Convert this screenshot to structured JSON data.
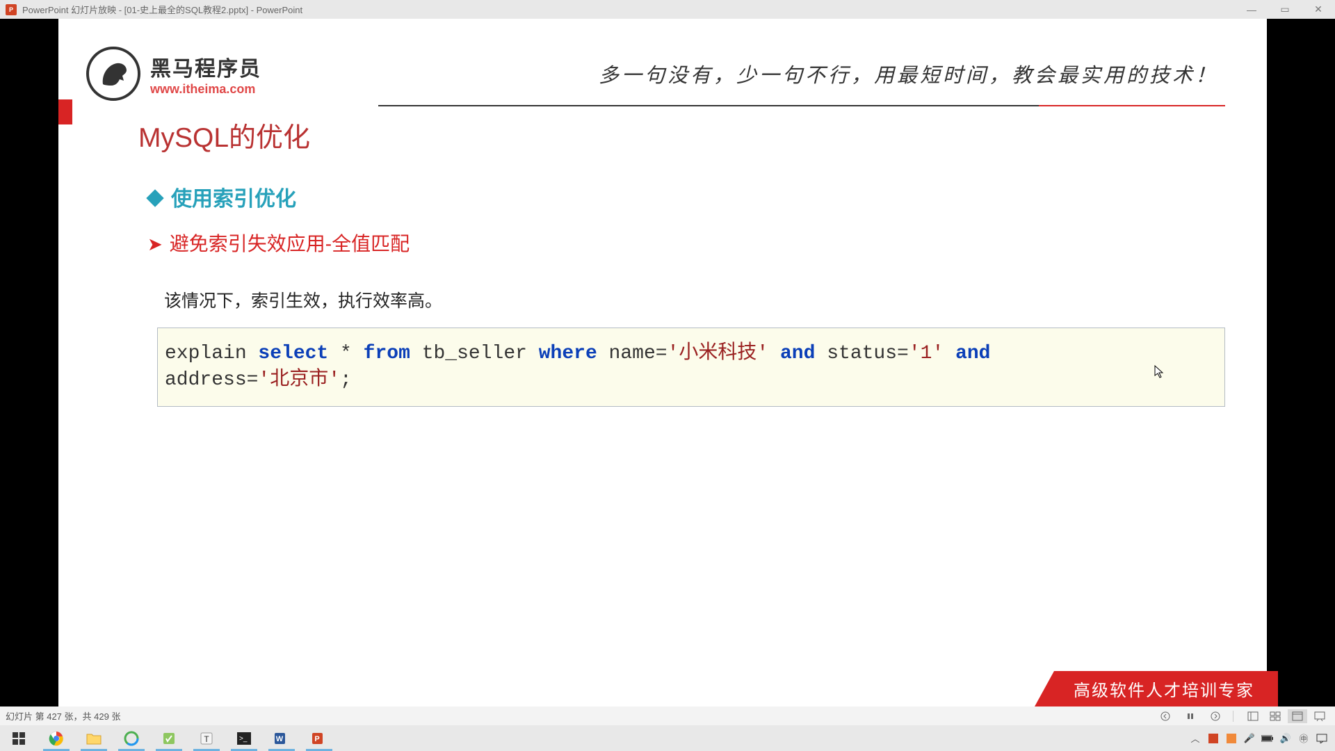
{
  "titlebar": {
    "app_icon_label": "P",
    "title": "PowerPoint 幻灯片放映 - [01-史上最全的SQL教程2.pptx] - PowerPoint"
  },
  "slide": {
    "logo_cn": "黑马程序员",
    "logo_url": "www.itheima.com",
    "slogan": "多一句没有，少一句不行，用最短时间，教会最实用的技术！",
    "title": "MySQL的优化",
    "sub1": "使用索引优化",
    "sub2": "避免索引失效应用-全值匹配",
    "desc": "该情况下，索引生效，执行效率高。",
    "code": {
      "pre1": "explain ",
      "kw_select": "select",
      "star": " * ",
      "kw_from": "from",
      "tbl": " tb_seller ",
      "kw_where": "where",
      "col1": " name=",
      "str1": "'小米科技'",
      "sp1": " ",
      "kw_and1": "and",
      "col2": " status=",
      "str2": "'1'",
      "sp2": " ",
      "kw_and2": "and",
      "nl": "\naddress=",
      "str3": "'北京市'",
      "end": ";"
    },
    "footer_badge": "高级软件人才培训专家"
  },
  "statusbar": {
    "slide_info": "幻灯片 第 427 张，共 429 张"
  }
}
